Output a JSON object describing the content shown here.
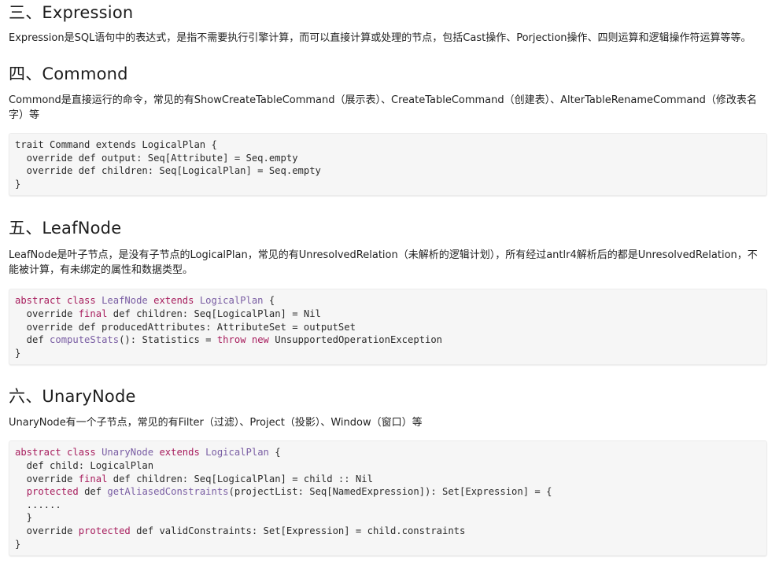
{
  "sections": [
    {
      "heading": "三、Expression",
      "paragraph": "Expression是SQL语句中的表达式，是指不需要执行引擎计算，而可以直接计算或处理的节点，包括Cast操作、Porjection操作、四则运算和逻辑操作符运算等等。"
    },
    {
      "heading": "四、Commond",
      "paragraph": "Commond是直接运行的命令，常见的有ShowCreateTableCommand（展示表）、CreateTableCommand（创建表）、AlterTableRenameCommand（修改表名字）等",
      "code": [
        [
          {
            "t": "trait Command extends LogicalPlan {"
          }
        ],
        [
          {
            "t": "  override def output: Seq[Attribute] = Seq.empty"
          }
        ],
        [
          {
            "t": "  override def children: Seq[LogicalPlan] = Seq.empty"
          }
        ],
        [
          {
            "t": "}"
          }
        ]
      ]
    },
    {
      "heading": "五、LeafNode",
      "paragraph": "LeafNode是叶子节点，是没有子节点的LogicalPlan，常见的有UnresolvedRelation（未解析的逻辑计划），所有经过antlr4解析后的都是UnresolvedRelation，不能被计算，有未绑定的属性和数据类型。",
      "code": [
        [
          {
            "t": "abstract class ",
            "c": "kw"
          },
          {
            "t": "LeafNode",
            "c": "ty"
          },
          {
            "t": " extends ",
            "c": "kw"
          },
          {
            "t": "LogicalPlan",
            "c": "ty"
          },
          {
            "t": " {"
          }
        ],
        [
          {
            "t": "  override "
          },
          {
            "t": "final",
            "c": "kw"
          },
          {
            "t": " def children: Seq[LogicalPlan] = Nil"
          }
        ],
        [
          {
            "t": "  override def producedAttributes: AttributeSet = outputSet"
          }
        ],
        [
          {
            "t": "  def "
          },
          {
            "t": "computeStats",
            "c": "fn"
          },
          {
            "t": "(): Statistics = "
          },
          {
            "t": "throw",
            "c": "kw"
          },
          {
            "t": " "
          },
          {
            "t": "new",
            "c": "kw"
          },
          {
            "t": " UnsupportedOperationException"
          }
        ],
        [
          {
            "t": "}"
          }
        ]
      ]
    },
    {
      "heading": "六、UnaryNode",
      "paragraph": "UnaryNode有一个子节点，常见的有Filter（过滤）、Project（投影）、Window（窗口）等",
      "code": [
        [
          {
            "t": "abstract class ",
            "c": "kw"
          },
          {
            "t": "UnaryNode",
            "c": "ty"
          },
          {
            "t": " extends ",
            "c": "kw"
          },
          {
            "t": "LogicalPlan",
            "c": "ty"
          },
          {
            "t": " {"
          }
        ],
        [
          {
            "t": "  def child: LogicalPlan"
          }
        ],
        [
          {
            "t": "  override "
          },
          {
            "t": "final",
            "c": "kw"
          },
          {
            "t": " def children: Seq[LogicalPlan] = child :: Nil"
          }
        ],
        [
          {
            "t": "  "
          },
          {
            "t": "protected",
            "c": "kw"
          },
          {
            "t": " def "
          },
          {
            "t": "getAliasedConstraints",
            "c": "fn"
          },
          {
            "t": "(projectList: Seq[NamedExpression]): Set[Expression] = {"
          }
        ],
        [
          {
            "t": "  ......"
          }
        ],
        [
          {
            "t": "  }"
          }
        ],
        [
          {
            "t": "  override "
          },
          {
            "t": "protected",
            "c": "kw"
          },
          {
            "t": " def validConstraints: Set[Expression] = child.constraints"
          }
        ],
        [
          {
            "t": "}"
          }
        ]
      ]
    }
  ]
}
